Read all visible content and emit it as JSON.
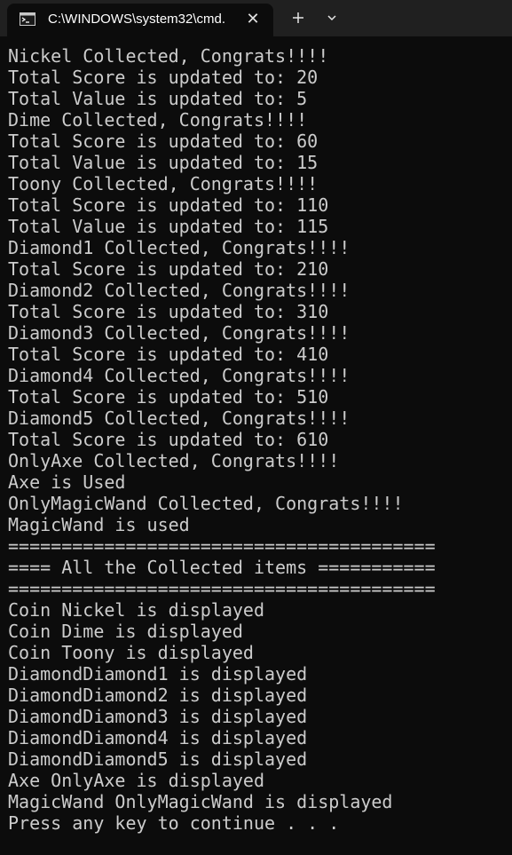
{
  "tab": {
    "title": "C:\\WINDOWS\\system32\\cmd.",
    "icon": "cmd-icon"
  },
  "toolbar": {
    "close_glyph": "✕",
    "new_tab_icon": "plus-icon",
    "dropdown_icon": "chevron-down-icon"
  },
  "colors": {
    "background": "#0c0c0c",
    "tabbar": "#202020",
    "text": "#cccccc"
  },
  "console": {
    "lines": [
      "Nickel Collected, Congrats!!!!",
      "Total Score is updated to: 20",
      "Total Value is updated to: 5",
      "Dime Collected, Congrats!!!!",
      "Total Score is updated to: 60",
      "Total Value is updated to: 15",
      "Toony Collected, Congrats!!!!",
      "Total Score is updated to: 110",
      "Total Value is updated to: 115",
      "Diamond1 Collected, Congrats!!!!",
      "Total Score is updated to: 210",
      "Diamond2 Collected, Congrats!!!!",
      "Total Score is updated to: 310",
      "Diamond3 Collected, Congrats!!!!",
      "Total Score is updated to: 410",
      "Diamond4 Collected, Congrats!!!!",
      "Total Score is updated to: 510",
      "Diamond5 Collected, Congrats!!!!",
      "Total Score is updated to: 610",
      "OnlyAxe Collected, Congrats!!!!",
      "Axe is Used",
      "OnlyMagicWand Collected, Congrats!!!!",
      "MagicWand is used",
      "========================================",
      "==== All the Collected items ===========",
      "========================================",
      "Coin Nickel is displayed",
      "Coin Dime is displayed",
      "Coin Toony is displayed",
      "DiamondDiamond1 is displayed",
      "DiamondDiamond2 is displayed",
      "DiamondDiamond3 is displayed",
      "DiamondDiamond4 is displayed",
      "DiamondDiamond5 is displayed",
      "Axe OnlyAxe is displayed",
      "MagicWand OnlyMagicWand is displayed",
      "Press any key to continue . . ."
    ]
  }
}
